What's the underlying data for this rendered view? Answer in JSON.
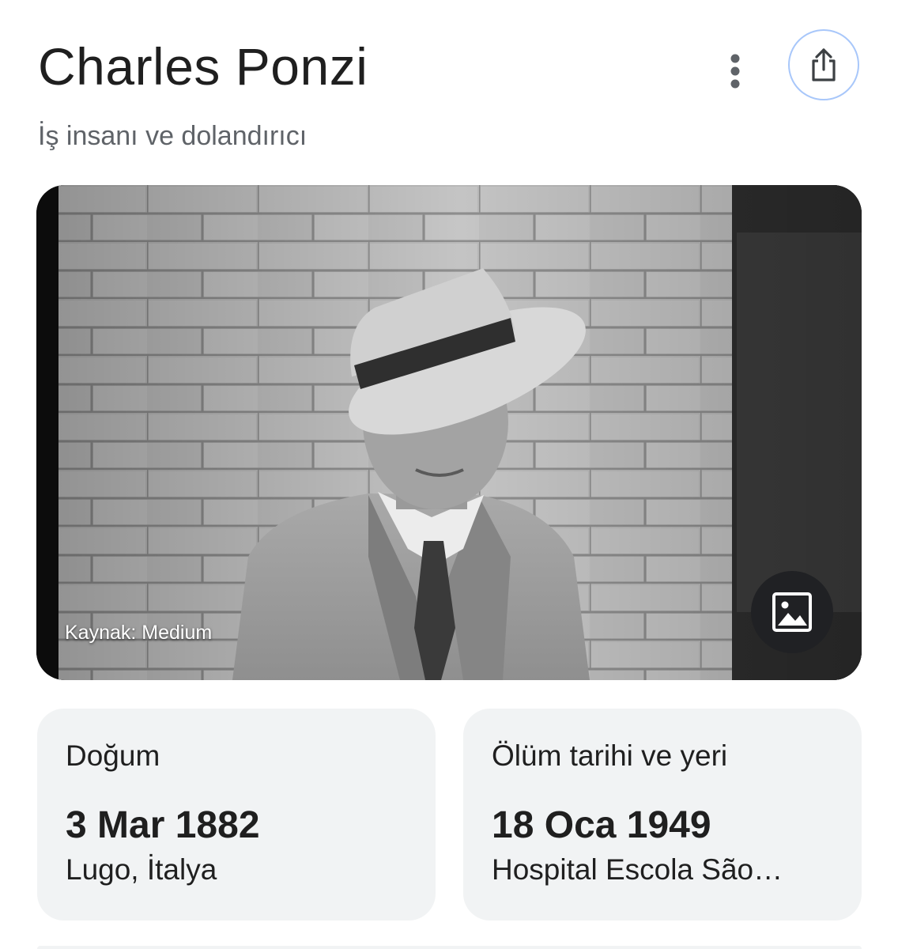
{
  "header": {
    "title": "Charles Ponzi",
    "subtitle": "İş insanı ve dolandırıcı",
    "more_icon": "more-vertical-icon",
    "share_icon": "share-icon",
    "share_border_color": "#a8c7fa"
  },
  "photo": {
    "caption": "Kaynak: Medium",
    "image_button_icon": "image-icon"
  },
  "facts": {
    "birth": {
      "label": "Doğum",
      "date": "3 Mar 1882",
      "place": "Lugo, İtalya"
    },
    "death": {
      "label": "Ölüm tarihi ve yeri",
      "date": "18 Oca 1949",
      "place": "Hospital Escola São…"
    }
  }
}
